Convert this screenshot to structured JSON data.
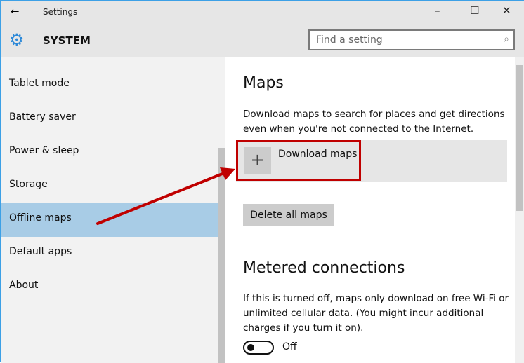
{
  "window": {
    "title": "Settings",
    "back": "←",
    "minimize": "–",
    "maximize": "☐",
    "close": "✕"
  },
  "header": {
    "icon": "gear-icon",
    "section": "SYSTEM",
    "search_placeholder": "Find a setting"
  },
  "sidebar": {
    "items": [
      {
        "label": "Tablet mode"
      },
      {
        "label": "Battery saver"
      },
      {
        "label": "Power & sleep"
      },
      {
        "label": "Storage"
      },
      {
        "label": "Offline maps",
        "selected": true
      },
      {
        "label": "Default apps"
      },
      {
        "label": "About"
      }
    ]
  },
  "maps": {
    "title": "Maps",
    "description": "Download maps to search for places and get directions even when you're not connected to the Internet.",
    "download_label": "Download maps",
    "delete_label": "Delete all maps"
  },
  "metered": {
    "title": "Metered connections",
    "description": "If this is turned off, maps only download on free Wi-Fi or unlimited cellular data. (You might incur additional charges if you turn it on).",
    "toggle_state": "Off"
  },
  "colors": {
    "accent": "#2b88d8",
    "selected": "#a8cce6",
    "annotation": "#c00000"
  }
}
